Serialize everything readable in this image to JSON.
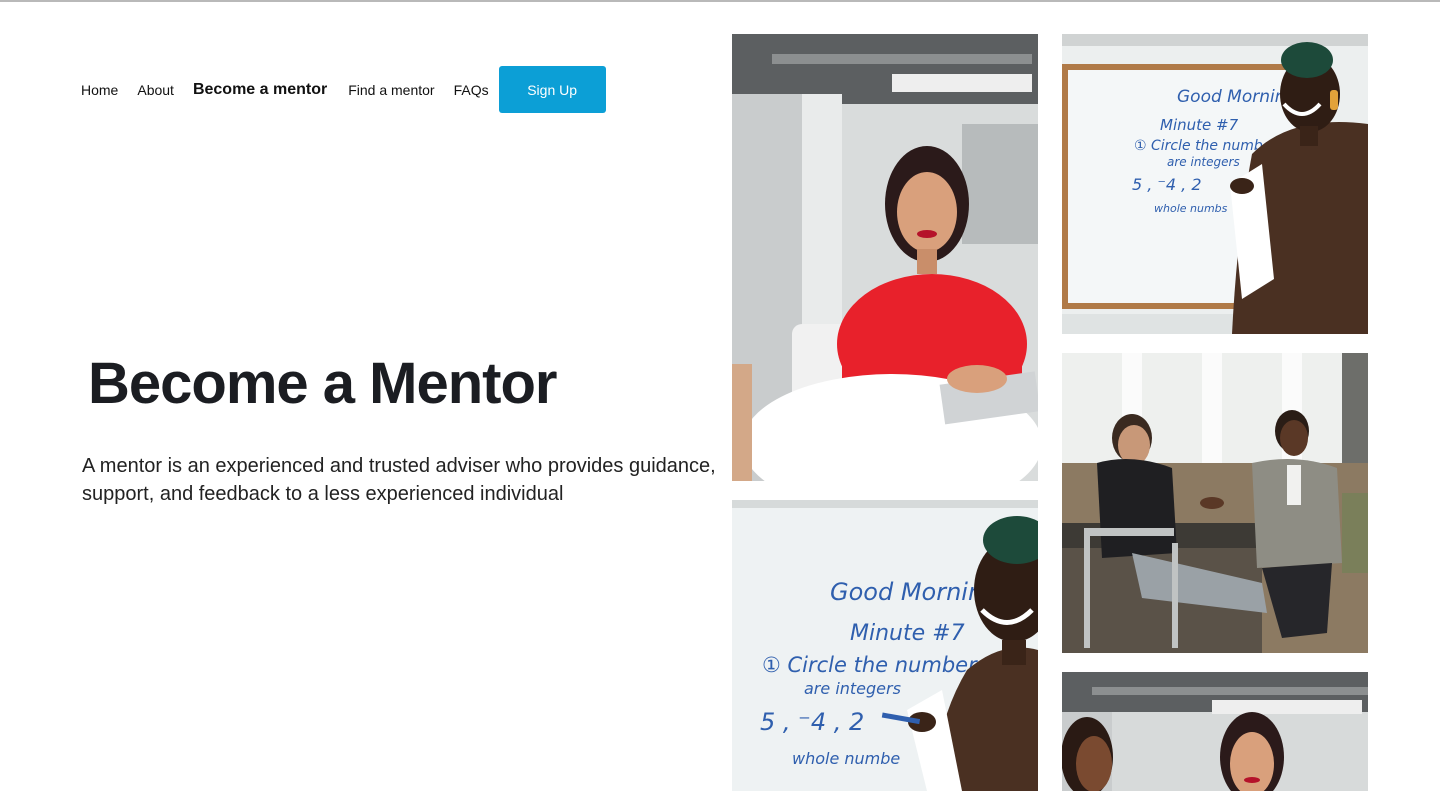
{
  "nav": {
    "items": [
      {
        "label": "Home"
      },
      {
        "label": "About"
      },
      {
        "label": "Become a mentor"
      },
      {
        "label": "Find a mentor"
      },
      {
        "label": "FAQs"
      }
    ],
    "signup_label": "Sign Up"
  },
  "hero": {
    "title": "Become a Mentor",
    "description": "A mentor is an experienced and trusted adviser who provides guidance, support, and feedback to a less experienced individual"
  },
  "colors": {
    "accent": "#0c9fd6",
    "title": "#1b1d22"
  },
  "photos": [
    {
      "icon": "woman-red-shirt-photo"
    },
    {
      "icon": "teacher-whiteboard-photo"
    },
    {
      "icon": "two-men-conversation-photo"
    },
    {
      "icon": "teacher-whiteboard-photo"
    },
    {
      "icon": "women-office-photo"
    }
  ]
}
